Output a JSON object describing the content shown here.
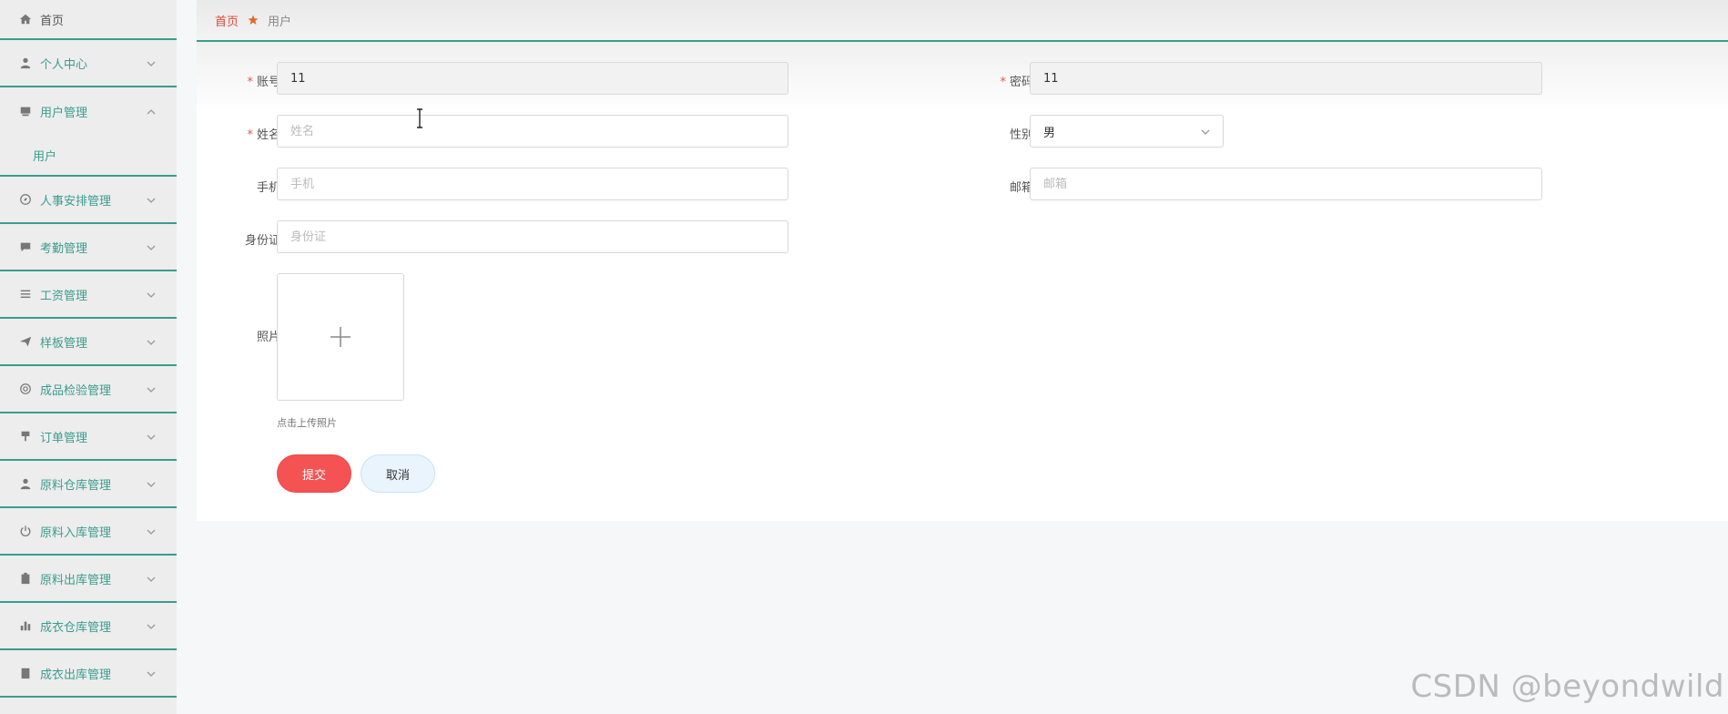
{
  "breadcrumb": {
    "home": "首页",
    "current": "用户"
  },
  "sidebar": {
    "items": [
      {
        "label": "首页",
        "icon": "home-icon"
      },
      {
        "label": "个人中心",
        "icon": "user-icon"
      },
      {
        "label": "用户管理",
        "icon": "monitor-icon",
        "expanded": true,
        "sub": "用户"
      },
      {
        "label": "人事安排管理",
        "icon": "compass-icon"
      },
      {
        "label": "考勤管理",
        "icon": "chat-icon"
      },
      {
        "label": "工资管理",
        "icon": "list-icon"
      },
      {
        "label": "样板管理",
        "icon": "send-icon"
      },
      {
        "label": "成品检验管理",
        "icon": "lifebuoy-icon"
      },
      {
        "label": "订单管理",
        "icon": "brush-icon"
      },
      {
        "label": "原料仓库管理",
        "icon": "person-icon"
      },
      {
        "label": "原料入库管理",
        "icon": "power-icon"
      },
      {
        "label": "原料出库管理",
        "icon": "clipboard-icon"
      },
      {
        "label": "成衣仓库管理",
        "icon": "bar-chart-icon"
      },
      {
        "label": "成衣出库管理",
        "icon": "document-icon"
      }
    ]
  },
  "form": {
    "account": {
      "label": "账号",
      "value": "11"
    },
    "password": {
      "label": "密码",
      "value": "11"
    },
    "name": {
      "label": "姓名",
      "placeholder": "姓名"
    },
    "gender": {
      "label": "性别",
      "value": "男"
    },
    "phone": {
      "label": "手机",
      "placeholder": "手机"
    },
    "email": {
      "label": "邮箱",
      "placeholder": "邮箱"
    },
    "idcard": {
      "label": "身份证",
      "placeholder": "身份证"
    },
    "photo": {
      "label": "照片",
      "hint": "点击上传照片"
    },
    "submit": "提交",
    "cancel": "取消"
  },
  "colors": {
    "accent": "#3b9c8e",
    "danger": "#f55353",
    "home_crumb": "#d94c3c"
  },
  "watermark": "CSDN @beyondwild"
}
